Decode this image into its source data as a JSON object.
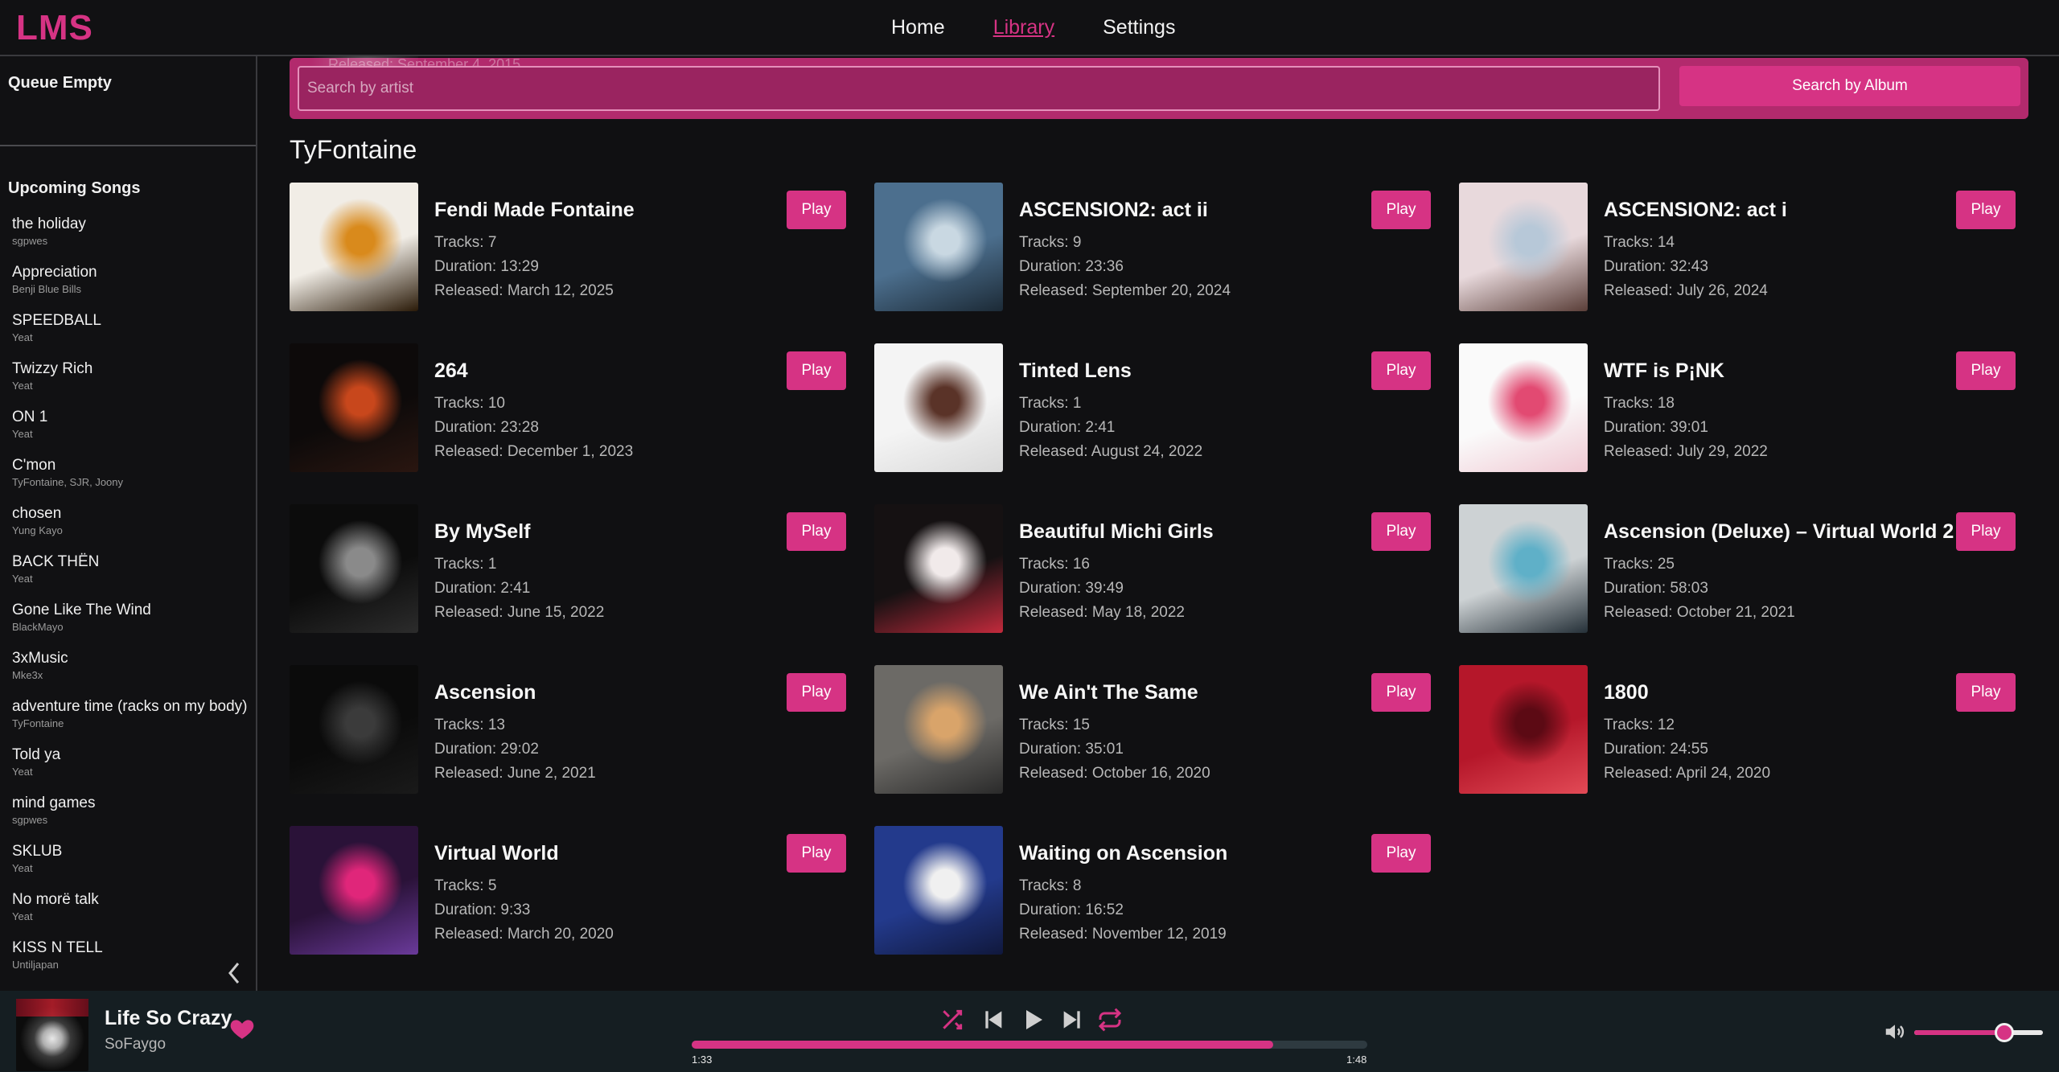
{
  "app": {
    "logo": "LMS"
  },
  "nav": {
    "items": [
      "Home",
      "Library",
      "Settings"
    ],
    "active": "Library"
  },
  "queue": {
    "status": "Queue Empty"
  },
  "upcoming": {
    "title": "Upcoming Songs",
    "songs": [
      {
        "title": "the holiday",
        "artist": "sgpwes"
      },
      {
        "title": "Appreciation",
        "artist": "Benji Blue Bills"
      },
      {
        "title": "SPEEDBALL",
        "artist": "Yeat"
      },
      {
        "title": "Twizzy Rich",
        "artist": "Yeat"
      },
      {
        "title": "ON 1",
        "artist": "Yeat"
      },
      {
        "title": "C'mon",
        "artist": "TyFontaine,  SJR,  Joony"
      },
      {
        "title": "chosen",
        "artist": "Yung Kayo"
      },
      {
        "title": "BACK THËN",
        "artist": "Yeat"
      },
      {
        "title": "Gone Like The Wind",
        "artist": "BlackMayo"
      },
      {
        "title": "3xMusic",
        "artist": "Mke3x"
      },
      {
        "title": "adventure time (racks on my body)",
        "artist": "TyFontaine"
      },
      {
        "title": "Told ya",
        "artist": "Yeat"
      },
      {
        "title": "mind games",
        "artist": "sgpwes"
      },
      {
        "title": "SKLUB",
        "artist": "Yeat"
      },
      {
        "title": "No morë talk",
        "artist": "Yeat"
      },
      {
        "title": "KISS N TELL",
        "artist": "Untiljapan"
      }
    ]
  },
  "search": {
    "ghost_text": "Released: September 4, 2015",
    "placeholder": "Search by artist",
    "button_label": "Search by Album"
  },
  "artist": {
    "name": "TyFontaine"
  },
  "albums": [
    {
      "title": "Fendi Made Fontaine",
      "tracks": "Tracks: 7",
      "duration": "Duration: 13:29",
      "released": "Released: March 12, 2025",
      "play": "Play",
      "cover_colors": [
        "#f1ede6",
        "#d98a1c",
        "#2a1a08"
      ]
    },
    {
      "title": "ASCENSION2: act ii",
      "tracks": "Tracks: 9",
      "duration": "Duration: 23:36",
      "released": "Released: September 20, 2024",
      "play": "Play",
      "cover_colors": [
        "#4c6f8e",
        "#c9d8e2",
        "#1c2a36"
      ]
    },
    {
      "title": "ASCENSION2: act i",
      "tracks": "Tracks: 14",
      "duration": "Duration: 32:43",
      "released": "Released: July 26, 2024",
      "play": "Play",
      "cover_colors": [
        "#e8d9dc",
        "#b7c8d8",
        "#5a3e38"
      ]
    },
    {
      "title": "264",
      "tracks": "Tracks: 10",
      "duration": "Duration: 23:28",
      "released": "Released: December 1, 2023",
      "play": "Play",
      "cover_colors": [
        "#0d0a0a",
        "#c8471c",
        "#2a1610"
      ]
    },
    {
      "title": "Tinted Lens",
      "tracks": "Tracks: 1",
      "duration": "Duration: 2:41",
      "released": "Released: August 24, 2022",
      "play": "Play",
      "cover_colors": [
        "#f4f4f4",
        "#5a3328",
        "#d9d9d9"
      ]
    },
    {
      "title": "WTF is P¡NK",
      "tracks": "Tracks: 18",
      "duration": "Duration: 39:01",
      "released": "Released: July 29, 2022",
      "play": "Play",
      "cover_colors": [
        "#fafafa",
        "#e24a72",
        "#f0c9d3"
      ]
    },
    {
      "title": "By MySelf",
      "tracks": "Tracks: 1",
      "duration": "Duration: 2:41",
      "released": "Released: June 15, 2022",
      "play": "Play",
      "cover_colors": [
        "#0c0c0c",
        "#8a8a8a",
        "#2c2c2c"
      ]
    },
    {
      "title": "Beautiful Michi Girls",
      "tracks": "Tracks: 16",
      "duration": "Duration: 39:49",
      "released": "Released: May 18, 2022",
      "play": "Play",
      "cover_colors": [
        "#151112",
        "#f1eaea",
        "#c22a3c"
      ]
    },
    {
      "title": "Ascension (Deluxe) – Virtual World 2",
      "tracks": "Tracks: 25",
      "duration": "Duration: 58:03",
      "released": "Released: October 21, 2021",
      "play": "Play",
      "cover_colors": [
        "#cdd2d4",
        "#5fb0c8",
        "#253038"
      ]
    },
    {
      "title": "Ascension",
      "tracks": "Tracks: 13",
      "duration": "Duration: 29:02",
      "released": "Released: June 2, 2021",
      "play": "Play",
      "cover_colors": [
        "#0b0b0b",
        "#3b3b3b",
        "#1a1a1a"
      ]
    },
    {
      "title": "We Ain't The Same",
      "tracks": "Tracks: 15",
      "duration": "Duration: 35:01",
      "released": "Released: October 16, 2020",
      "play": "Play",
      "cover_colors": [
        "#6c6a66",
        "#d9a46a",
        "#2a2a2a"
      ]
    },
    {
      "title": "1800",
      "tracks": "Tracks: 12",
      "duration": "Duration: 24:55",
      "released": "Released: April 24, 2020",
      "play": "Play",
      "cover_colors": [
        "#b5172a",
        "#5c0a14",
        "#e24a56"
      ]
    },
    {
      "title": "Virtual World",
      "tracks": "Tracks: 5",
      "duration": "Duration: 9:33",
      "released": "Released: March 20, 2020",
      "play": "Play",
      "cover_colors": [
        "#2a1238",
        "#e0267a",
        "#6a3a9a"
      ]
    },
    {
      "title": "Waiting on Ascension",
      "tracks": "Tracks: 8",
      "duration": "Duration: 16:52",
      "released": "Released: November 12, 2019",
      "play": "Play",
      "cover_colors": [
        "#233a8c",
        "#f0f0f0",
        "#10183c"
      ]
    }
  ],
  "player": {
    "title": "Life So Crazy",
    "artist": "SoFaygo",
    "liked": true,
    "current_time": "1:33",
    "total_time": "1:48",
    "progress": 0.861,
    "volume": 0.7,
    "icons": [
      "heart-icon",
      "shuffle-icon",
      "previous-icon",
      "play-icon",
      "next-icon",
      "repeat-icon",
      "volume-icon"
    ]
  },
  "colors": {
    "accent": "#d63384",
    "background": "#101012",
    "player_bg": "#151e22"
  }
}
